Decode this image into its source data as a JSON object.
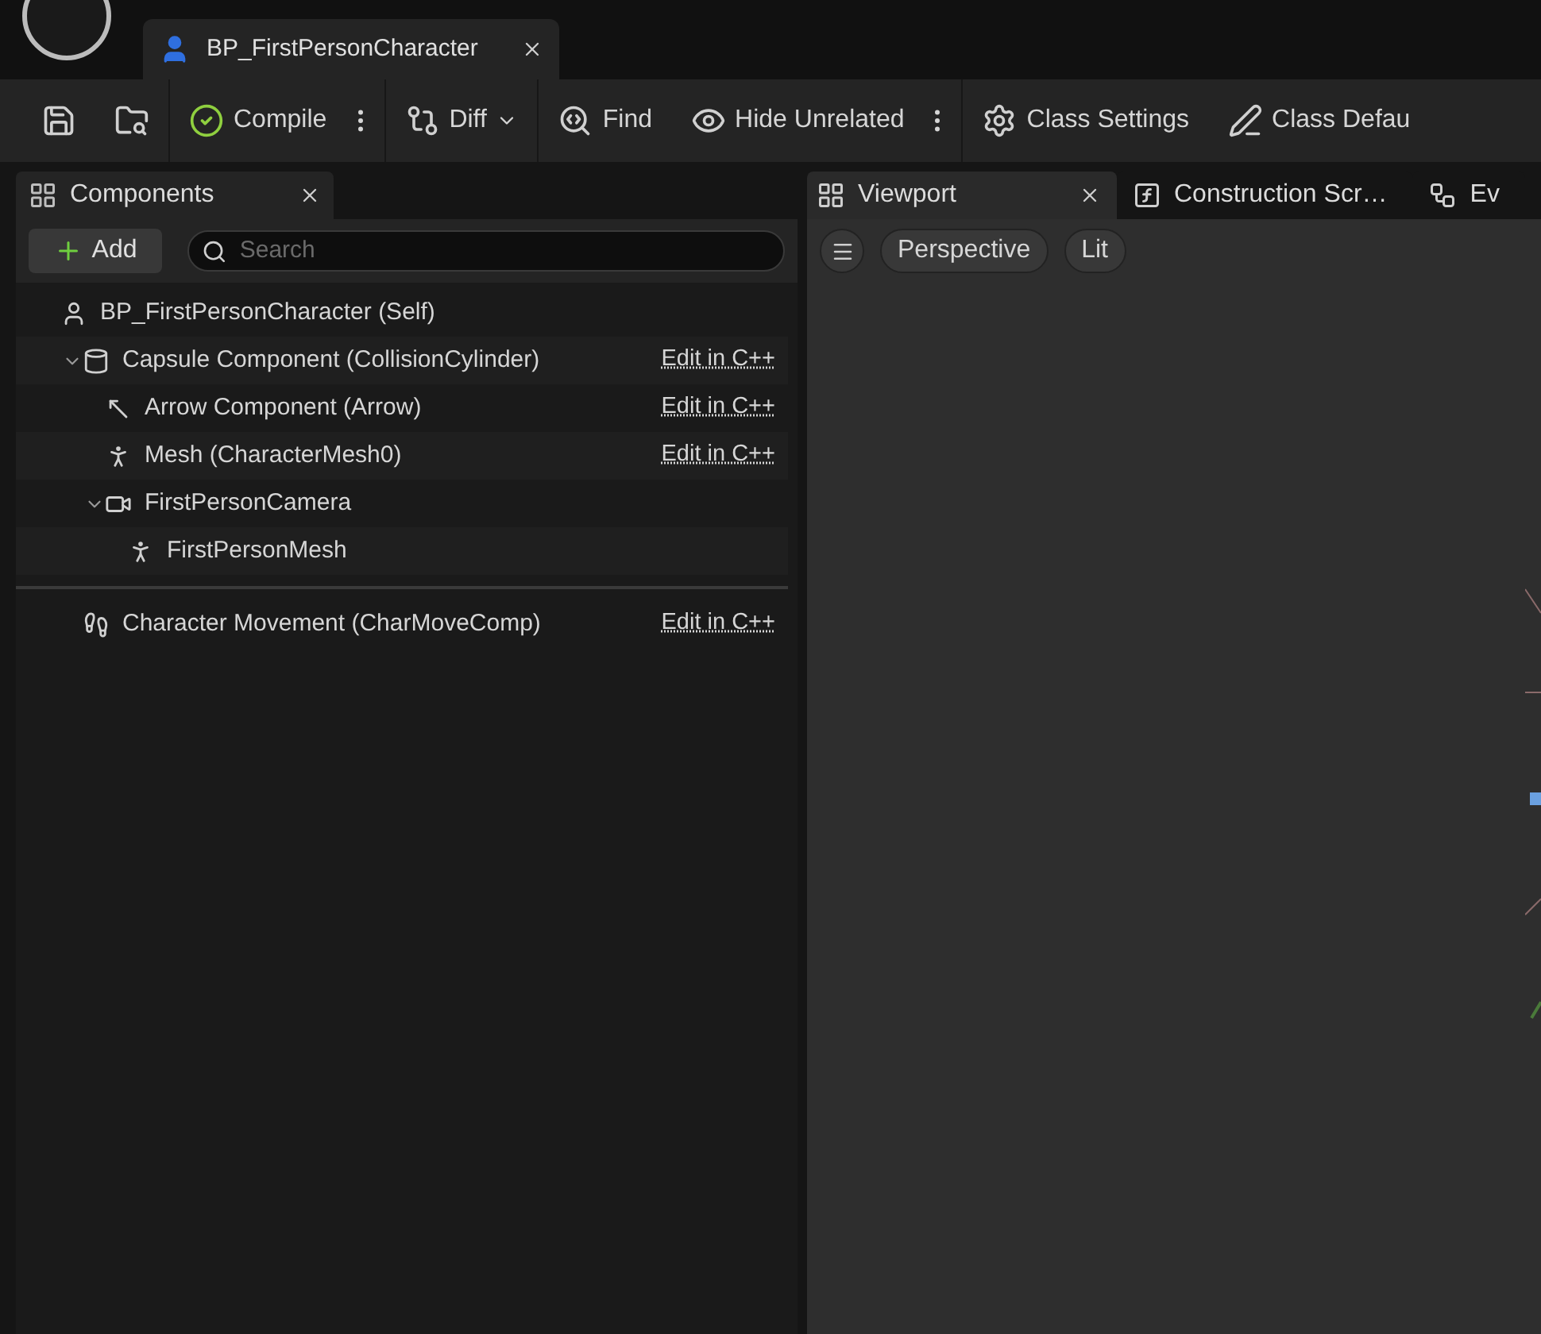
{
  "document_tab": {
    "label": "BP_FirstPersonCharacter",
    "selected": true
  },
  "toolbar": [
    {
      "kind": "save"
    },
    {
      "kind": "browse"
    },
    {
      "kind": "compile",
      "label": "Compile",
      "menu": true
    },
    {
      "kind": "diff",
      "label": "Diff",
      "dropdown": true
    },
    {
      "kind": "find",
      "label": "Find"
    },
    {
      "kind": "hide",
      "label": "Hide Unrelated",
      "menu": true
    },
    {
      "kind": "settings",
      "label": "Class Settings"
    },
    {
      "kind": "defaults",
      "label": "Class Defau"
    }
  ],
  "components_panel": {
    "tab": {
      "label": "Components",
      "selected": true
    },
    "add_button": "Add",
    "search": {
      "placeholder": "Search"
    },
    "tree": [
      {
        "kind": "actor",
        "label": "BP_FirstPersonCharacter (Self)",
        "children": [
          {
            "kind": "capsule",
            "label": "Capsule Component (CollisionCylinder)",
            "edit_link": "Edit in C++",
            "expanded": true,
            "children": [
              {
                "kind": "arrow",
                "label": "Arrow Component (Arrow)",
                "edit_link": "Edit in C++"
              },
              {
                "kind": "skeleton",
                "label": "Mesh (CharacterMesh0)",
                "edit_link": "Edit in C++"
              },
              {
                "kind": "camera",
                "label": "FirstPersonCamera",
                "expanded": true,
                "children": [
                  {
                    "kind": "skeleton",
                    "label": "FirstPersonMesh"
                  }
                ]
              }
            ]
          }
        ]
      }
    ],
    "movement_components": [
      {
        "kind": "movement",
        "label": "Character Movement (CharMoveComp)",
        "edit_link": "Edit in C++"
      }
    ]
  },
  "editor_tabs": [
    {
      "kind": "viewport",
      "label": "Viewport",
      "selected": true
    },
    {
      "kind": "function",
      "label": "Construction Scr…",
      "selected": false
    },
    {
      "kind": "graph",
      "label": "Ev",
      "selected": false
    }
  ],
  "viewport_toolbar": {
    "buttons": [
      "Perspective",
      "Lit"
    ]
  }
}
